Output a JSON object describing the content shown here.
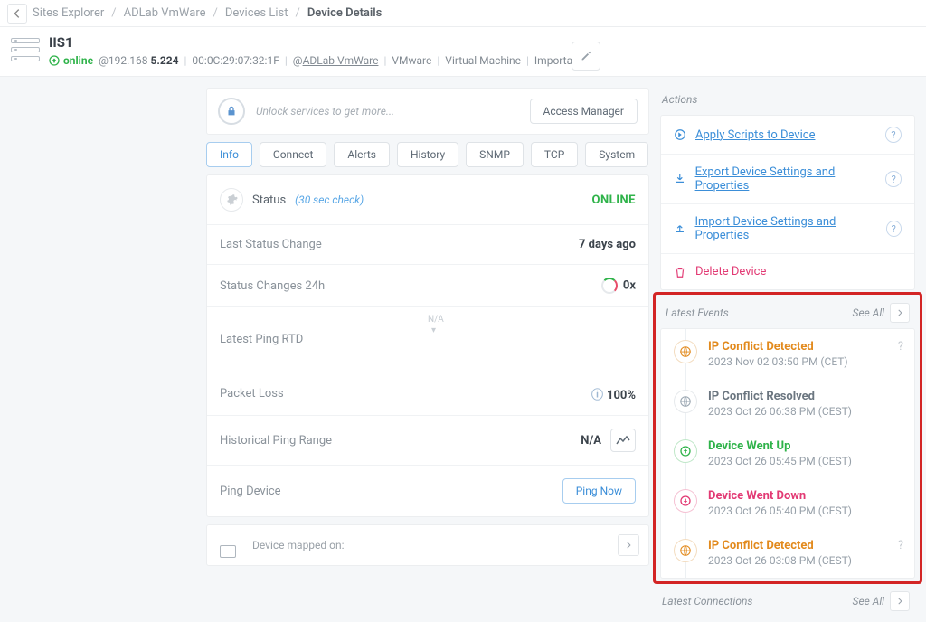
{
  "breadcrumbs": {
    "back": "‹",
    "a": "Sites Explorer",
    "b": "ADLab VmWare",
    "c": "Devices List",
    "current": "Device Details"
  },
  "device": {
    "name": "IIS1",
    "status": "online",
    "ip_prefix": "@192.168",
    "ip_bold": " 5.224",
    "mac": "00:0C:29:07:32:1F",
    "site_prefix": "@",
    "site": "ADLab VmWare",
    "vendor": "VMware",
    "type": "Virtual Machine",
    "importance": "Important"
  },
  "unlock": {
    "text": "Unlock services to get more...",
    "button": "Access Manager"
  },
  "tabs": {
    "info": "Info",
    "connect": "Connect",
    "alerts": "Alerts",
    "history": "History",
    "snmp": "SNMP",
    "tcp": "TCP",
    "system": "System"
  },
  "status": {
    "label": "Status",
    "interval": "(30 sec check)",
    "value": "ONLINE",
    "last_change_label": "Last Status Change",
    "last_change_value": "7 days ago",
    "changes24_label": "Status Changes 24h",
    "changes24_value": "0x",
    "latest_ping_label": "Latest Ping RTD",
    "latest_ping_na": "N/A",
    "packet_loss_label": "Packet Loss",
    "packet_loss_value": "100%",
    "hist_range_label": "Historical Ping Range",
    "hist_range_value": "N/A",
    "ping_device_label": "Ping Device",
    "ping_now": "Ping Now"
  },
  "mapped": {
    "label": "Device mapped on:"
  },
  "actions": {
    "title": "Actions",
    "apply": "Apply Scripts to Device",
    "export": "Export Device Settings and Properties",
    "import": "Import Device Settings and Properties",
    "delete": "Delete Device"
  },
  "events": {
    "title": "Latest Events",
    "see_all": "See All",
    "items": [
      {
        "title": "IP Conflict Detected",
        "time": "2023 Nov 02 03:50 PM (CET)",
        "kind": "orange",
        "q": true
      },
      {
        "title": "IP Conflict Resolved",
        "time": "2023 Oct 26 06:38 PM (CEST)",
        "kind": "gray",
        "q": false
      },
      {
        "title": "Device Went Up",
        "time": "2023 Oct 26 05:45 PM (CEST)",
        "kind": "green",
        "q": false
      },
      {
        "title": "Device Went Down",
        "time": "2023 Oct 26 05:40 PM (CEST)",
        "kind": "pink",
        "q": false
      },
      {
        "title": "IP Conflict Detected",
        "time": "2023 Oct 26 03:08 PM (CEST)",
        "kind": "orange",
        "q": true
      }
    ]
  },
  "connections": {
    "title": "Latest Connections",
    "see_all": "See All"
  }
}
